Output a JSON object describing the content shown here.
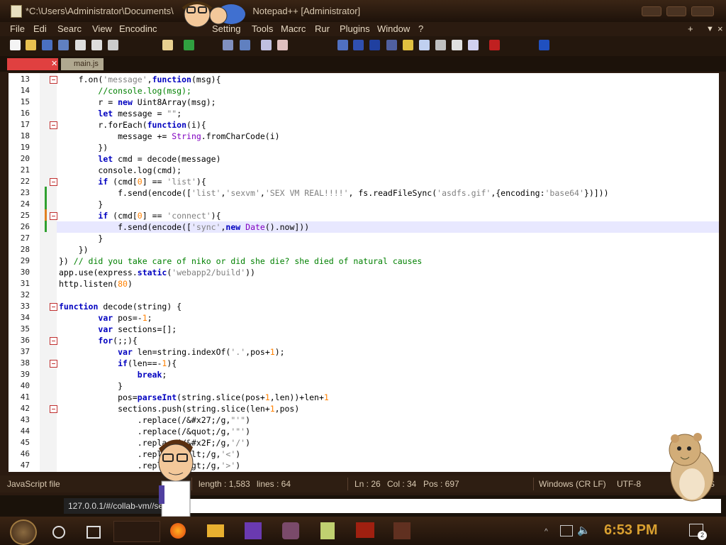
{
  "window": {
    "title": "*C:\\Users\\Administrator\\Documents\\",
    "title_suffix": "Notepad++ [Administrator]",
    "buttons": [
      "minimize",
      "maximize",
      "close"
    ]
  },
  "menu": {
    "items": [
      "File",
      "Edi",
      "Searc",
      "View",
      "Encodinc",
      "Setting",
      "Tools",
      "Macrc",
      "Rur",
      "Plugins",
      "Window",
      "?"
    ],
    "right": [
      "+",
      "▼",
      "×"
    ]
  },
  "tabs": [
    {
      "label": "",
      "active": true
    },
    {
      "label": "main.js",
      "active": false
    }
  ],
  "editor": {
    "lines": [
      {
        "n": "13",
        "html": "    f.on(<span class='str'>'message'</span>,<span class='kw'>function</span>(msg){"
      },
      {
        "n": "14",
        "html": "        <span class='cmt'>//console.log(msg);</span>"
      },
      {
        "n": "15",
        "html": "        r = <span class='kw'>new</span> Uint8Array(msg);"
      },
      {
        "n": "16",
        "html": "        <span class='kw'>let</span> message = <span class='str'>\"\"</span>;"
      },
      {
        "n": "17",
        "html": "        r.forEach(<span class='kw'>function</span>(i){"
      },
      {
        "n": "18",
        "html": "            message += <span class='obj'>String</span>.fromCharCode(i)"
      },
      {
        "n": "19",
        "html": "        })"
      },
      {
        "n": "20",
        "html": "        <span class='kw'>let</span> cmd = decode(message)"
      },
      {
        "n": "21",
        "html": "        console.log(cmd);"
      },
      {
        "n": "22",
        "html": "        <span class='kw'>if</span> (cmd[<span class='num'>0</span>] == <span class='str'>'list'</span>){"
      },
      {
        "n": "23",
        "html": "            f.send(encode([<span class='str'>'list'</span>,<span class='str'>'sexvm'</span>,<span class='str'>'SEX VM REAL!!!!'</span>, fs.readFileSync(<span class='str'>'asdfs.gif'</span>,{encoding:<span class='str'>'base64'</span>})]))"
      },
      {
        "n": "24",
        "html": "        }"
      },
      {
        "n": "25",
        "html": "        <span class='kw'>if</span> (cmd[<span class='num'>0</span>] == <span class='str'>'connect'</span>){"
      },
      {
        "n": "26",
        "html": "            f.send(encode([<span class='str'>'sync'</span>,<span class='kw'>new</span> <span class='obj'>Date</span>().now]))"
      },
      {
        "n": "27",
        "html": "        }"
      },
      {
        "n": "28",
        "html": "    })"
      },
      {
        "n": "29",
        "html": "}) <span class='cmt'>// did you take care of niko or did she die? she died of natural causes</span>"
      },
      {
        "n": "30",
        "html": "app.use(express.<span class='kw'>static</span>(<span class='str'>'webapp2/build'</span>))"
      },
      {
        "n": "31",
        "html": "http.listen(<span class='num'>80</span>)"
      },
      {
        "n": "32",
        "html": ""
      },
      {
        "n": "33",
        "html": "<span class='kw'>function</span> decode(string) {"
      },
      {
        "n": "34",
        "html": "        <span class='kw'>var</span> pos=-<span class='num'>1</span>;"
      },
      {
        "n": "35",
        "html": "        <span class='kw'>var</span> sections=[];"
      },
      {
        "n": "36",
        "html": "        <span class='kw'>for</span>(;;){"
      },
      {
        "n": "37",
        "html": "            <span class='kw'>var</span> len=string.indexOf(<span class='str'>'.'</span>,pos+<span class='num'>1</span>);"
      },
      {
        "n": "38",
        "html": "            <span class='kw'>if</span>(len==-<span class='num'>1</span>){"
      },
      {
        "n": "39",
        "html": "                <span class='kw'>break</span>;"
      },
      {
        "n": "40",
        "html": "            }"
      },
      {
        "n": "41",
        "html": "            pos=<span class='kw'>parseInt</span>(string.slice(pos+<span class='num'>1</span>,len))+len+<span class='num'>1</span>"
      },
      {
        "n": "42",
        "html": "            sections.push(string.slice(len+<span class='num'>1</span>,pos)"
      },
      {
        "n": "43",
        "html": "                .replace(/&amp;#x27;/g,<span class='str'>\"'\"</span>)"
      },
      {
        "n": "44",
        "html": "                .replace(/&amp;quot;/g,<span class='str'>'\"'</span>)"
      },
      {
        "n": "45",
        "html": "                .replace(/&amp;#x2F;/g,<span class='str'>'/'</span>)"
      },
      {
        "n": "46",
        "html": "                .replace(/&amp;lt;/g,<span class='str'>'&lt;'</span>)"
      },
      {
        "n": "47",
        "html": "                .replace(/&amp;gt;/g,<span class='str'>'&gt;'</span>)"
      }
    ],
    "fold_lines": [
      "13",
      "17",
      "22",
      "25",
      "33",
      "36",
      "38",
      "42"
    ],
    "current_line": "26"
  },
  "status": {
    "filetype": "JavaScript file",
    "length": "length : 1,583",
    "lines": "lines : 64",
    "ln": "Ln : 26",
    "col": "Col : 34",
    "pos": "Pos : 697",
    "eol": "Windows (CR LF)",
    "encoding": "UTF-8",
    "mode": "S"
  },
  "browser": {
    "url": "127.0.0.1/#/collab-vm//se"
  },
  "taskbar": {
    "clock": "6:53 PM",
    "notifications": "2"
  },
  "colors": {
    "accent": "#d9a030",
    "titlebar": "#2b1b10"
  }
}
